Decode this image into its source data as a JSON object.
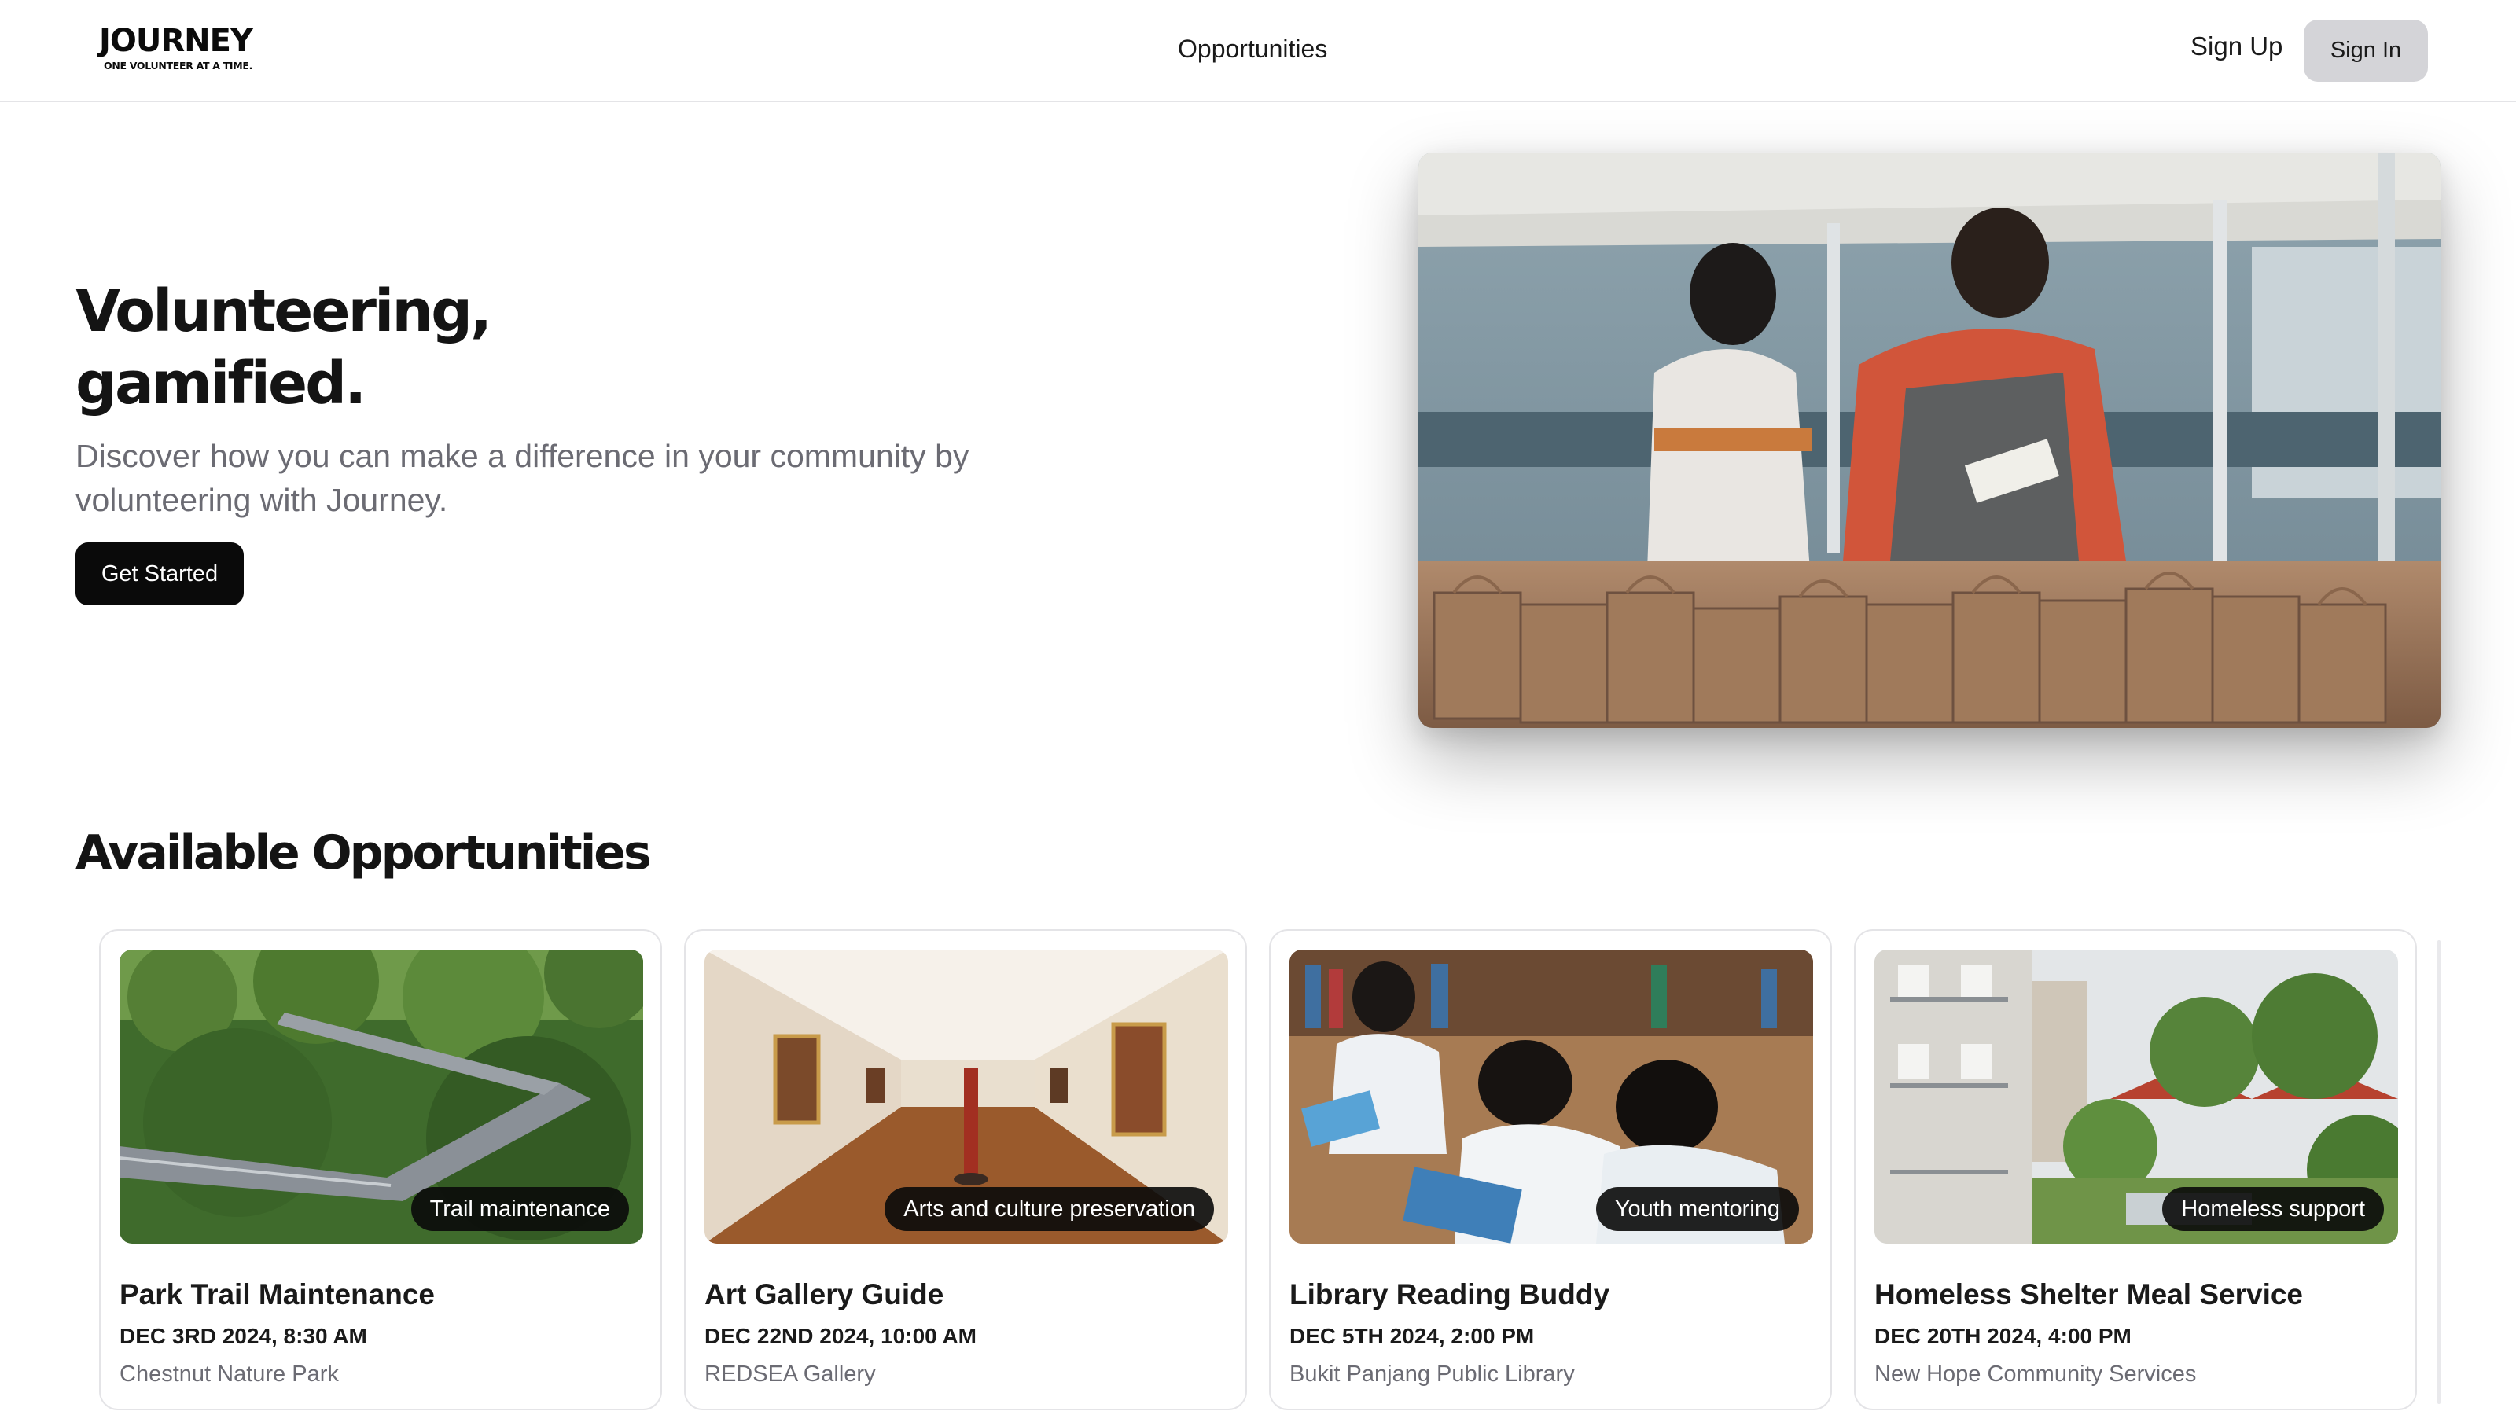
{
  "header": {
    "logo": {
      "name": "JOURNEY",
      "tagline": "ONE VOLUNTEER AT A TIME."
    },
    "nav": {
      "opportunities": "Opportunities"
    },
    "auth": {
      "sign_up": "Sign Up",
      "sign_in": "Sign In"
    }
  },
  "hero": {
    "title_line1": "Volunteering,",
    "title_line2": "gamified.",
    "subtitle": "Discover how you can make a difference in your community by volunteering with Journey.",
    "cta": "Get Started"
  },
  "opportunities": {
    "heading": "Available Opportunities",
    "cards": [
      {
        "category": "Trail maintenance",
        "title": "Park Trail Maintenance",
        "date": "DEC 3RD 2024, 8:30 AM",
        "location": "Chestnut Nature Park"
      },
      {
        "category": "Arts and culture preservation",
        "title": "Art Gallery Guide",
        "date": "DEC 22ND 2024, 10:00 AM",
        "location": "REDSEA Gallery"
      },
      {
        "category": "Youth mentoring",
        "title": "Library Reading Buddy",
        "date": "DEC 5TH 2024, 2:00 PM",
        "location": "Bukit Panjang Public Library"
      },
      {
        "category": "Homeless support",
        "title": "Homeless Shelter Meal Service",
        "date": "DEC 20TH 2024, 4:00 PM",
        "location": "New Hope Community Services"
      }
    ]
  },
  "colors": {
    "primary_button": "#0a0a0a",
    "secondary_button": "#d4d4d8",
    "muted_text": "#6b6b73",
    "border": "#e4e4e7"
  }
}
